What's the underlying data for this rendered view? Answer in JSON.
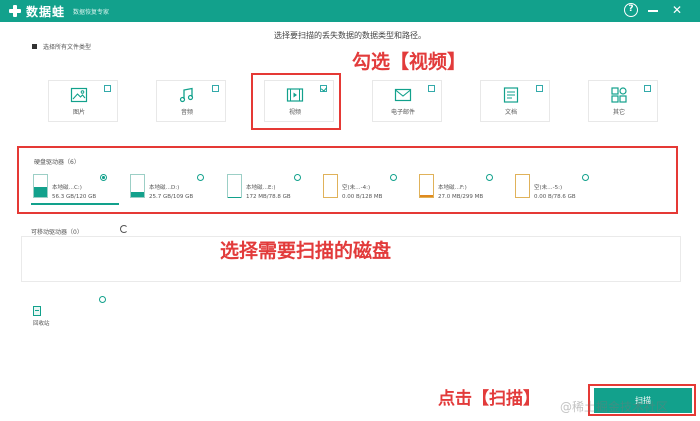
{
  "window": {
    "app_name": "数据蛙",
    "app_subtitle": "数据恢复专家"
  },
  "headline": "选择要扫描的丢失数据的数据类型和路径。",
  "select_all": {
    "label": "选择所有文件类型",
    "checked": true
  },
  "file_types": [
    {
      "label": "图片",
      "icon": "image-icon",
      "checked": false
    },
    {
      "label": "音频",
      "icon": "music-icon",
      "checked": false
    },
    {
      "label": "视频",
      "icon": "video-icon",
      "checked": true
    },
    {
      "label": "电子邮件",
      "icon": "mail-icon",
      "checked": false
    },
    {
      "label": "文档",
      "icon": "document-icon",
      "checked": false
    },
    {
      "label": "其它",
      "icon": "other-icon",
      "checked": false
    }
  ],
  "hdd_section": {
    "title": "硬盘驱动器（6）",
    "drives": [
      {
        "name": "本地磁…C:)",
        "size": "56.3 GB/120 GB",
        "fill": 0.47,
        "selected": true,
        "type": "ntfs"
      },
      {
        "name": "本地磁…D:)",
        "size": "25.7 GB/109 GB",
        "fill": 0.24,
        "selected": false,
        "type": "ntfs"
      },
      {
        "name": "本地磁…E:)",
        "size": "172 MB/78.8 GB",
        "fill": 0.02,
        "selected": false,
        "type": "ntfs"
      },
      {
        "name": "空(未…-4:)",
        "size": "0.00 B/128 MB",
        "fill": 0.0,
        "selected": false,
        "type": "fat"
      },
      {
        "name": "本地磁…F:)",
        "size": "27.0 MB/299 MB",
        "fill": 0.09,
        "selected": false,
        "type": "fat"
      },
      {
        "name": "空(未…-5:)",
        "size": "0.00 B/78.6 GB",
        "fill": 0.0,
        "selected": false,
        "type": "fat"
      }
    ]
  },
  "removable_section": {
    "title": "可移动驱动器（0）"
  },
  "recycle_bin": {
    "label": "回收站",
    "selected": false
  },
  "scan_button": {
    "label": "扫描"
  },
  "annotations": {
    "select_video": "勾选【视频】",
    "select_disk": "选择需要扫描的磁盘",
    "click_scan": "点击【扫描】"
  },
  "watermark": "@稀土掘金技术社区",
  "colors": {
    "brand": "#12a18c",
    "annotation": "#e23b3b"
  }
}
